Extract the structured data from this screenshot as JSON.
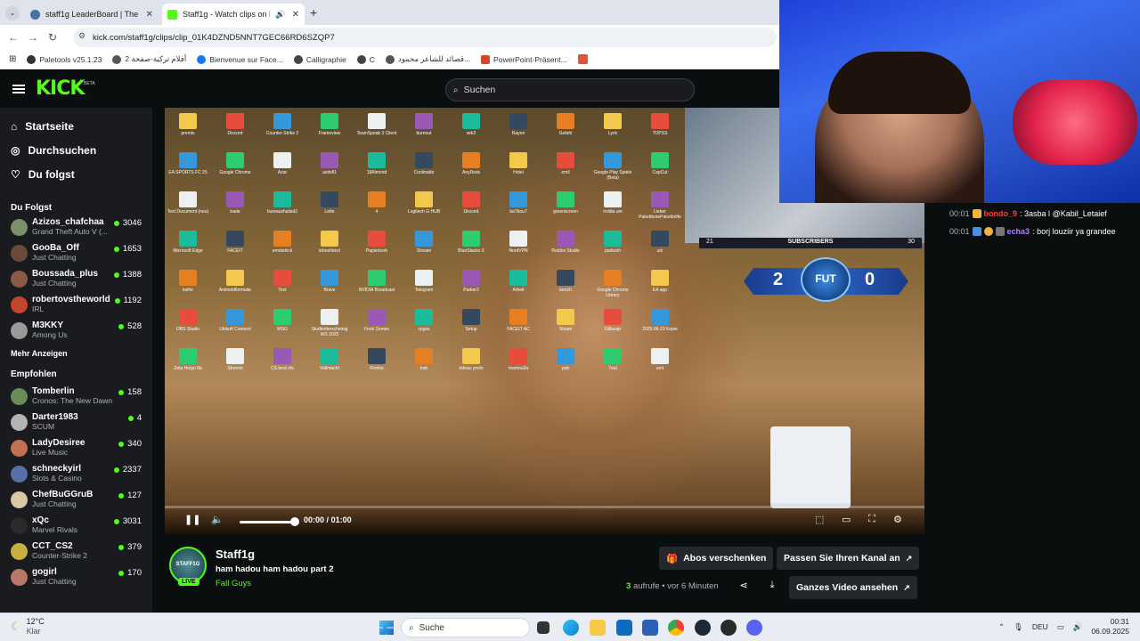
{
  "browser": {
    "tabs": [
      {
        "title": "staff1g LeaderBoard | The best"
      },
      {
        "title": "Staff1g - Watch clips on Kic"
      }
    ],
    "new_tab": "+",
    "url": "kick.com/staff1g/clips/clip_01K4DZND5NNT7GEC66RD6SZQP7",
    "bookmarks": [
      "Paletools v25.1.23",
      "أفلام تركية-صفحة 2",
      "Bienvenue sur Face...",
      "Calligraphie",
      "C",
      "قصائد للشاعر محمود...",
      "PowerPoint-Präsent..."
    ]
  },
  "header": {
    "logo": "KICK",
    "logo_beta": "BETA",
    "search_placeholder": "Suchen"
  },
  "sidebar": {
    "nav": [
      {
        "label": "Startseite",
        "icon": "home-icon"
      },
      {
        "label": "Durchsuchen",
        "icon": "compass-icon"
      },
      {
        "label": "Du folgst",
        "icon": "heart-icon"
      }
    ],
    "following_title": "Du Folgst",
    "following": [
      {
        "name": "Azizos_chafchaa",
        "category": "Grand Theft Auto V (...",
        "viewers": "3046",
        "color": "#7a8f6a"
      },
      {
        "name": "GooBa_Off",
        "category": "Just Chatting",
        "viewers": "1653",
        "color": "#6b4a3c"
      },
      {
        "name": "Boussada_plus",
        "category": "Just Chatting",
        "viewers": "1388",
        "color": "#8a5a48"
      },
      {
        "name": "robertovstheworld",
        "category": "IRL",
        "viewers": "1192",
        "color": "#c4452b"
      },
      {
        "name": "M3KKY",
        "category": "Among Us",
        "viewers": "528",
        "color": "#9a9a9a"
      }
    ],
    "show_more": "Mehr Anzeigen",
    "recommended_title": "Empfohlen",
    "recommended": [
      {
        "name": "Tomberlin",
        "category": "Cronos: The New Dawn",
        "viewers": "158",
        "color": "#6a8b5a"
      },
      {
        "name": "Darter1983",
        "category": "SCUM",
        "viewers": "4",
        "color": "#b4b4b4"
      },
      {
        "name": "LadyDesiree",
        "category": "Live Music",
        "viewers": "340",
        "color": "#c27050"
      },
      {
        "name": "schneckyirl",
        "category": "Slots & Casino",
        "viewers": "2337",
        "color": "#5a6fa8"
      },
      {
        "name": "ChefBuGGruB",
        "category": "Just Chatting",
        "viewers": "127",
        "color": "#d8c8a8"
      },
      {
        "name": "xQc",
        "category": "Marvel Rivals",
        "viewers": "3031",
        "color": "#2a2a2a"
      },
      {
        "name": "CCT_CS2",
        "category": "Counter-Strike 2",
        "viewers": "379",
        "color": "#c8b040"
      },
      {
        "name": "gogirl",
        "category": "Just Chatting",
        "viewers": "170",
        "color": "#b87868"
      }
    ]
  },
  "player": {
    "desktop_icons": [
      "premis",
      "Discord",
      "Counter-Strike 2",
      "Frameview",
      "TeamSpeak 3 Client",
      "burnout",
      "wrk2",
      "Rayon",
      "Gefahl",
      "Lyric",
      "TOPSS",
      "EA SPORTS FC 25",
      "Google Chrome",
      "Azar",
      "azdoll1",
      "18Almond",
      "Coolmatte",
      "AnyDesk",
      "Hotel",
      "emil",
      "Google Play Spiele (Beta)",
      "CapCut",
      "Text Document (neu)",
      "trade",
      "bureaushailed2",
      "Lette",
      "4",
      "Logitech G HUB",
      "Discord",
      "ba7bou7",
      "greenscreen",
      "nvidia um",
      "Lieber PakettbotePaketbrilfe",
      "Microsoft Edge",
      "FACEIT",
      "emotekick",
      "lebnetlekol",
      "Papierkorb",
      "Stream",
      "BlueStacks X",
      "NordVPN",
      "Roblox Studio",
      "parkesh",
      "uni",
      "bsifer",
      "Animeldformular",
      "Text",
      "Brave",
      "NVIDIA Broadcast",
      "Telegram",
      "Parker3",
      "Arbeit",
      "bench",
      "Google Chrome Library",
      "EA app",
      "OBS Studio",
      "Ubisoft Connect",
      "WSG",
      "Studienbescheinig WS 2025",
      "Fresi Zemes",
      "cpgsz",
      "Setup",
      "FACEIT AC",
      "Steam",
      "Gillacap",
      "2025-06-23 Kopie",
      "Zeta Heigo 8a",
      "Stremio",
      "CS best ofs",
      "Vollmacht",
      "Firefox",
      "trah",
      "rideau ymlin",
      "mamou3a",
      "pub",
      "7out",
      "amt"
    ],
    "overlay": {
      "subscribers_label": "SUBSCRIBERS",
      "subscribers_left": "21",
      "subscribers_right": "30",
      "score_left": "2",
      "score_right": "0",
      "badge_text": "FUT"
    },
    "progress": 0.0,
    "volume": 0.9,
    "time_current": "00:00",
    "time_separator": "/",
    "time_total": "01:00"
  },
  "streamer": {
    "name": "Staff1g",
    "avatar_text": "STAFF1G",
    "live_label": "LIVE",
    "clip_title": "ham hadou ham hadou part 2",
    "category": "Fall Guys",
    "views_count": "3",
    "views_label": "aufrufe",
    "time_ago": "• vor 6 Minuten",
    "gift_button": "Abos verschenken",
    "customize_button": "Passen Sie Ihren Kanal an",
    "full_video_button": "Ganzes Video ansehen"
  },
  "chat": {
    "messages": [
      {
        "time": "00:01",
        "user": "bondo_9",
        "user_color": "#ff3b3b",
        "text": ": 3asba l @Kabil_Letaief"
      },
      {
        "time": "00:01",
        "user": "echa3",
        "user_color": "#b07bff",
        "text": ": borj louziir ya grandee"
      }
    ]
  },
  "taskbar": {
    "temperature": "12°C",
    "condition": "Klar",
    "search": "Suche",
    "language": "DEU",
    "time": "00:31",
    "date": "06.09.2025"
  }
}
